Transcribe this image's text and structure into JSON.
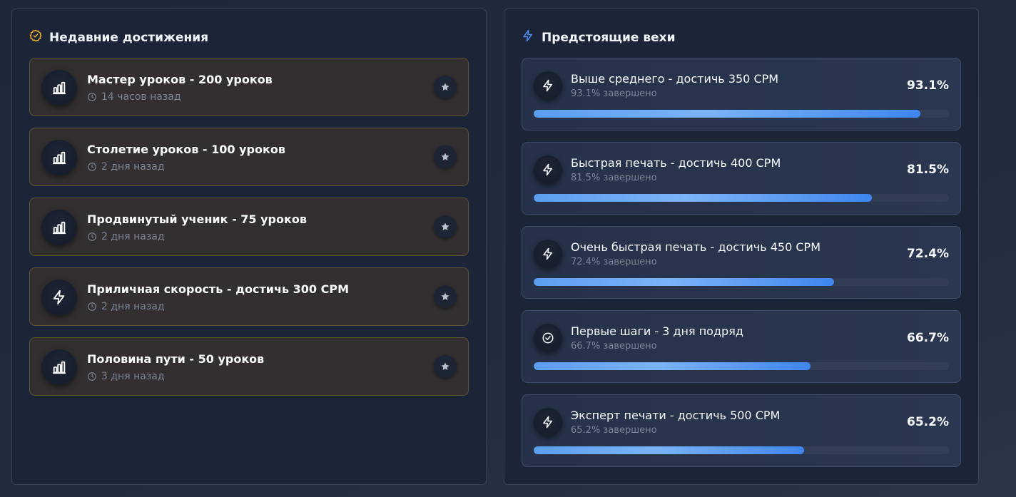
{
  "colors": {
    "achievement_accent": "#f5b52a",
    "milestone_accent": "#4f8ef2",
    "progress_fill": "#5b9ef0"
  },
  "achievements": {
    "title": "Недавние достижения",
    "title_icon": "badge-check-icon",
    "items": [
      {
        "title": "Мастер уроков - 200 уроков",
        "time": "14 часов назад",
        "icon": "bar-chart-icon"
      },
      {
        "title": "Столетие уроков - 100 уроков",
        "time": "2 дня назад",
        "icon": "bar-chart-icon"
      },
      {
        "title": "Продвинутый ученик - 75 уроков",
        "time": "2 дня назад",
        "icon": "bar-chart-icon"
      },
      {
        "title": "Приличная скорость - достичь 300 CPM",
        "time": "2 дня назад",
        "icon": "lightning-icon"
      },
      {
        "title": "Половина пути - 50 уроков",
        "time": "3 дня назад",
        "icon": "bar-chart-icon"
      }
    ]
  },
  "milestones": {
    "title": "Предстоящие вехи",
    "title_icon": "lightning-icon",
    "items": [
      {
        "title": "Выше среднего - достичь 350 CPM",
        "subtitle": "93.1% завершено",
        "percent_label": "93.1%",
        "progress": 93.1,
        "icon": "lightning-icon"
      },
      {
        "title": "Быстрая печать - достичь 400 CPM",
        "subtitle": "81.5% завершено",
        "percent_label": "81.5%",
        "progress": 81.5,
        "icon": "lightning-icon"
      },
      {
        "title": "Очень быстрая печать - достичь 450 CPM",
        "subtitle": "72.4% завершено",
        "percent_label": "72.4%",
        "progress": 72.4,
        "icon": "lightning-icon"
      },
      {
        "title": "Первые шаги - 3 дня подряд",
        "subtitle": "66.7% завершено",
        "percent_label": "66.7%",
        "progress": 66.7,
        "icon": "check-circle-icon"
      },
      {
        "title": "Эксперт печати - достичь 500 CPM",
        "subtitle": "65.2% завершено",
        "percent_label": "65.2%",
        "progress": 65.2,
        "icon": "lightning-icon"
      }
    ]
  }
}
